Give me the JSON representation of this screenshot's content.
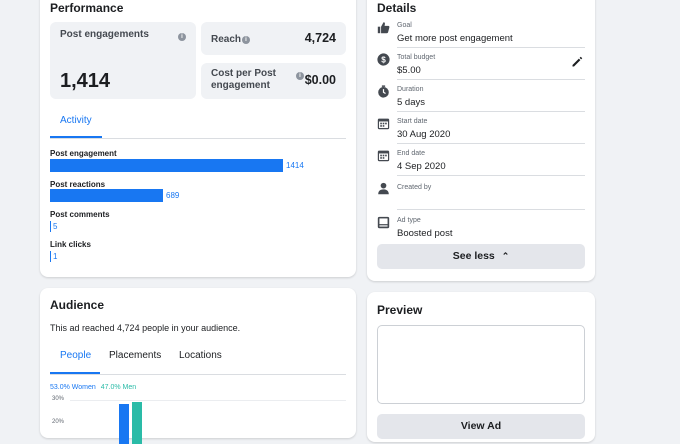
{
  "performance": {
    "title": "Performance",
    "post_engagements": {
      "label": "Post engagements",
      "value": "1,414"
    },
    "reach": {
      "label": "Reach",
      "value": "4,724"
    },
    "cost_per": {
      "label_line1": "Cost per Post",
      "label_line2": "engagement",
      "value": "$0.00"
    },
    "activity_tab": "Activity",
    "bars": [
      {
        "label": "Post engagement",
        "value": "1414",
        "fraction": 1.0
      },
      {
        "label": "Post reactions",
        "value": "689",
        "fraction": 0.487
      },
      {
        "label": "Post comments",
        "value": "5",
        "fraction": 0.0
      },
      {
        "label": "Link clicks",
        "value": "1",
        "fraction": 0.0
      }
    ],
    "accent": "#1877f2"
  },
  "details": {
    "title": "Details",
    "rows": [
      {
        "icon": "thumbs-up-icon",
        "key": "Goal",
        "value": "Get more post engagement"
      },
      {
        "icon": "dollar-icon",
        "key": "Total budget",
        "value": "$5.00"
      },
      {
        "icon": "clock-icon",
        "key": "Duration",
        "value": "5 days"
      },
      {
        "icon": "calendar-icon",
        "key": "Start date",
        "value": "30 Aug 2020"
      },
      {
        "icon": "calendar-icon",
        "key": "End date",
        "value": "4 Sep 2020"
      },
      {
        "icon": "person-icon",
        "key": "Created by",
        "value": ""
      },
      {
        "icon": "ad-type-icon",
        "key": "Ad type",
        "value": "Boosted post"
      }
    ],
    "see_less": "See less"
  },
  "audience": {
    "title": "Audience",
    "reach_prefix": "This ad reached ",
    "reach_count": "4,724",
    "reach_suffix": " people in your audience.",
    "tabs": [
      "People",
      "Placements",
      "Locations"
    ],
    "women_label": "53.0% Women",
    "men_label": "47.0% Men",
    "women_color": "#1877f2",
    "men_color": "#2abba7",
    "axis_ticks": [
      "30%",
      "20%"
    ]
  },
  "preview": {
    "title": "Preview",
    "button": "View Ad"
  }
}
